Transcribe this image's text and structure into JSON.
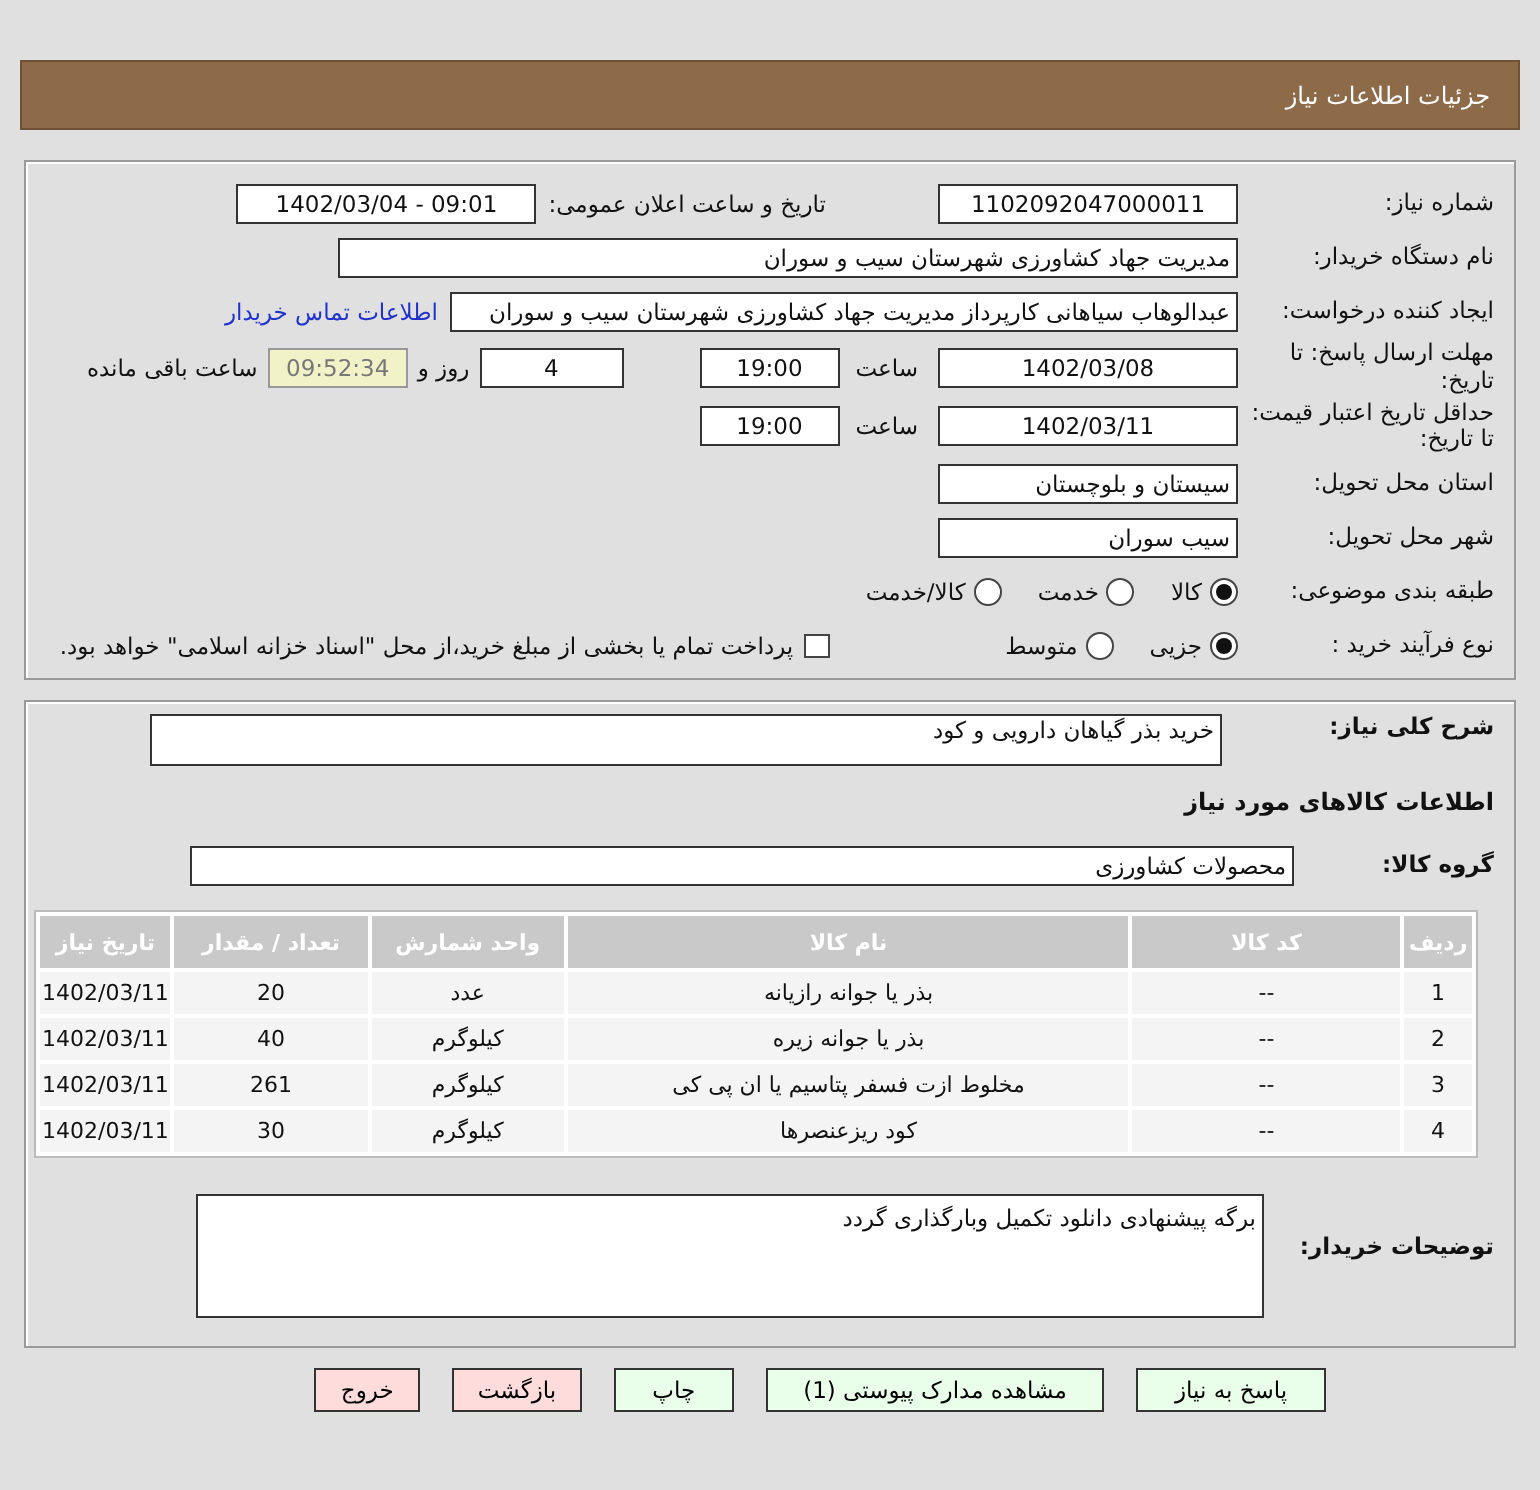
{
  "header": {
    "title": "جزئیات اطلاعات نیاز"
  },
  "need_number": {
    "label": "شماره نیاز:",
    "value": "1102092047000011"
  },
  "announce": {
    "label": "تاریخ و ساعت اعلان عمومی:",
    "value": "1402/03/04 - 09:01"
  },
  "buyer_org": {
    "label": "نام دستگاه خریدار:",
    "value": "مدیریت جهاد کشاورزی شهرستان سیب و سوران"
  },
  "requester": {
    "label": "ایجاد کننده درخواست:",
    "value": "عبدالوهاب سیاهانی کارپرداز مدیریت جهاد کشاورزی شهرستان سیب و سوران",
    "link": "اطلاعات تماس خریدار"
  },
  "deadline": {
    "label": "مهلت ارسال پاسخ: تا تاریخ:",
    "date": "1402/03/08",
    "time_label": "ساعت",
    "time": "19:00",
    "days": "4",
    "days_label": "روز و",
    "remaining": "09:52:34",
    "remaining_label": "ساعت باقی مانده"
  },
  "validity": {
    "label": "حداقل تاریخ اعتبار قیمت: تا تاریخ:",
    "date": "1402/03/11",
    "time_label": "ساعت",
    "time": "19:00"
  },
  "province": {
    "label": "استان محل تحویل:",
    "value": "سیستان و بلوچستان"
  },
  "city": {
    "label": "شهر محل تحویل:",
    "value": "سیب سوران"
  },
  "category": {
    "label": "طبقه بندی موضوعی:",
    "options": [
      {
        "label": "کالا",
        "selected": true
      },
      {
        "label": "خدمت",
        "selected": false
      },
      {
        "label": "کالا/خدمت",
        "selected": false
      }
    ]
  },
  "process": {
    "label": "نوع فرآیند خرید :",
    "options": [
      {
        "label": "جزیی",
        "selected": true
      },
      {
        "label": "متوسط",
        "selected": false
      }
    ],
    "checkbox": {
      "label": "پرداخت تمام یا بخشی از مبلغ خرید،از محل \"اسناد خزانه اسلامی\" خواهد بود.",
      "checked": false
    }
  },
  "description": {
    "label": "شرح کلی نیاز:",
    "value": "خرید بذر گیاهان دارویی و کود"
  },
  "goods_title": "اطلاعات کالاهای مورد نیاز",
  "group": {
    "label": "گروه کالا:",
    "value": "محصولات کشاورزی"
  },
  "table": {
    "columns": [
      "ردیف",
      "کد کالا",
      "نام کالا",
      "واحد شمارش",
      "تعداد / مقدار",
      "تاریخ نیاز"
    ],
    "rows": [
      [
        "1",
        "--",
        "بذر یا جوانه رازیانه",
        "عدد",
        "20",
        "1402/03/11"
      ],
      [
        "2",
        "--",
        "بذر یا جوانه زیره",
        "کیلوگرم",
        "40",
        "1402/03/11"
      ],
      [
        "3",
        "--",
        "مخلوط ازت فسفر پتاسیم یا ان پی کی",
        "کیلوگرم",
        "261",
        "1402/03/11"
      ],
      [
        "4",
        "--",
        "کود ریزعنصرها",
        "کیلوگرم",
        "30",
        "1402/03/11"
      ]
    ]
  },
  "notes": {
    "label": "توضیحات خریدار:",
    "value": "برگه پیشنهادی دانلود تکمیل وبارگذاری گردد"
  },
  "buttons": [
    {
      "label": "پاسخ به نیاز",
      "kind": "green"
    },
    {
      "label": "مشاهده مدارک پیوستی (1)",
      "kind": "green"
    },
    {
      "label": "چاپ",
      "kind": "green"
    },
    {
      "label": "بازگشت",
      "kind": "red"
    },
    {
      "label": "خروج",
      "kind": "red"
    }
  ]
}
